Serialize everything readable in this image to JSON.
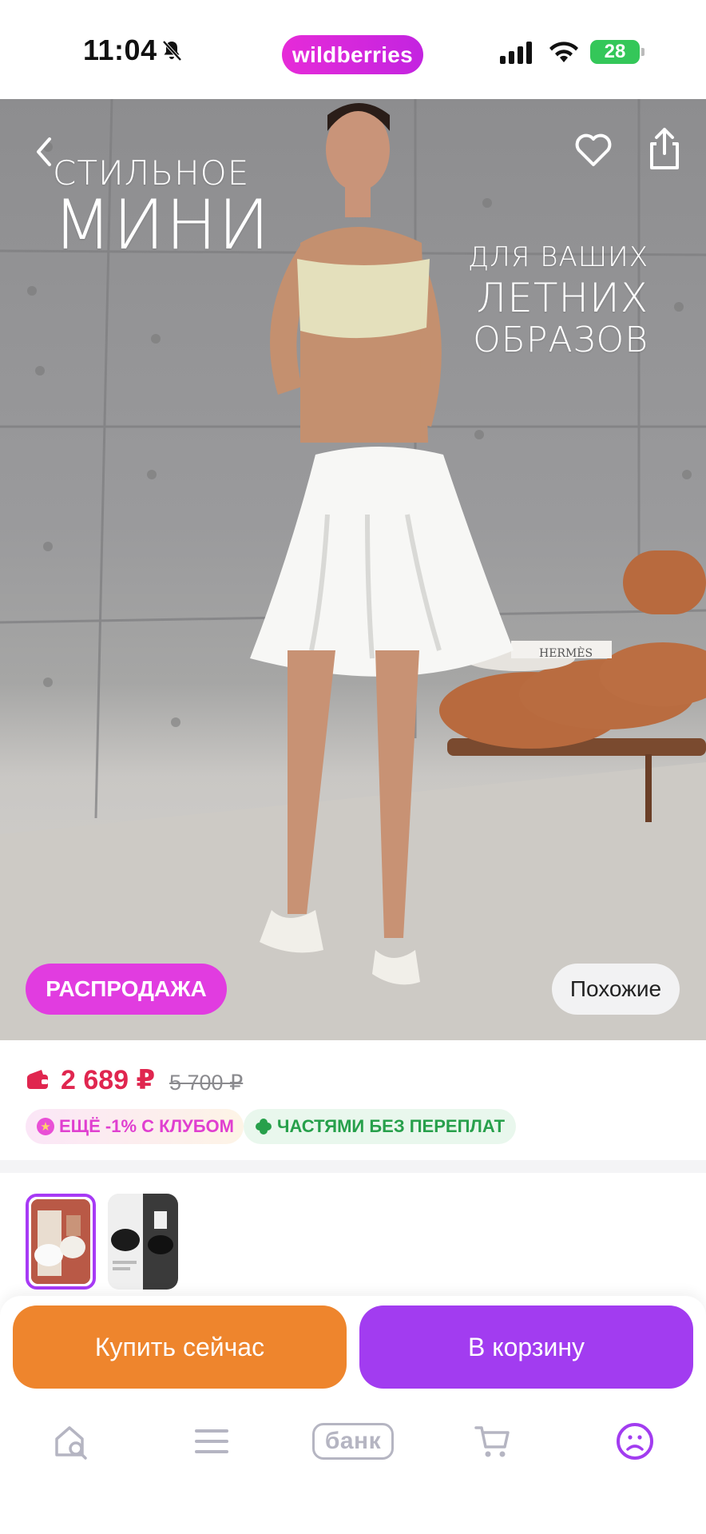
{
  "status_bar": {
    "time": "11:04",
    "brand": "wildberries",
    "battery": "28"
  },
  "hero": {
    "promo_line1": "СТИЛЬНОЕ",
    "promo_line2": "МИНИ",
    "promo_line3": "ДЛЯ ВАШИХ",
    "promo_line4": "ЛЕТНИХ",
    "promo_line5": "ОБРАЗОВ",
    "book_title": "HERMÈS",
    "sale_badge": "РАСПРОДАЖА",
    "similar_button": "Похожие"
  },
  "price": {
    "current": "2 689 ₽",
    "old": "5 700 ₽",
    "club_chip": "ЕЩЁ -1% С КЛУБОМ",
    "installments_chip": "ЧАСТЯМИ БЕЗ ПЕРЕПЛАТ"
  },
  "actions": {
    "buy_now": "Купить сейчас",
    "add_to_cart": "В корзину"
  },
  "bottom_nav": {
    "bank_label": "банк",
    "icons": [
      "home-search-icon",
      "catalog-menu-icon",
      "bank-icon",
      "cart-icon",
      "profile-icon"
    ]
  },
  "colors": {
    "brand": "#cb2be0",
    "price_red": "#e0264f",
    "buy_now": "#ee852d",
    "to_cart": "#a23cf0",
    "active_nav": "#a23cf0",
    "inactive_nav": "#b5b5c2"
  }
}
